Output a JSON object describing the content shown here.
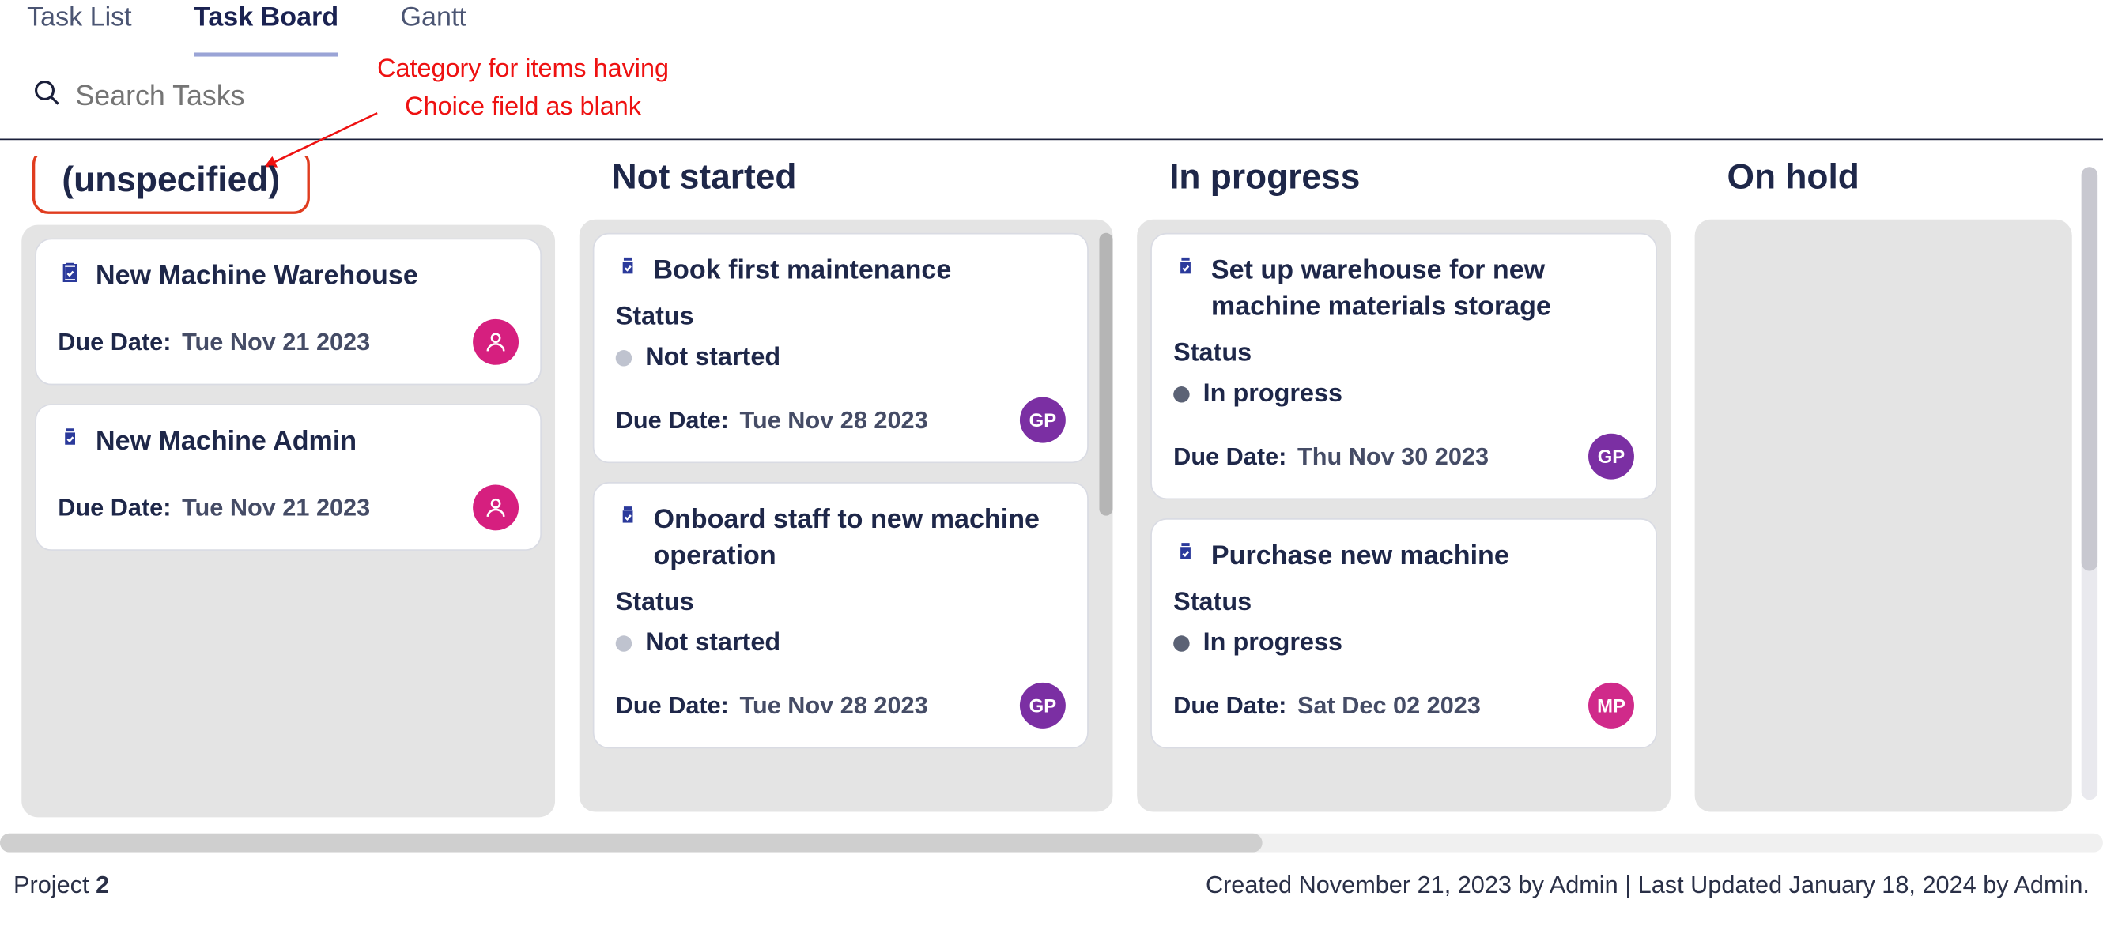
{
  "tabs": {
    "task_list": "Task List",
    "task_board": "Task Board",
    "gantt": "Gantt"
  },
  "search": {
    "placeholder": "Search Tasks"
  },
  "annotation": {
    "line1": "Category for items having",
    "line2": "Choice field as blank"
  },
  "labels": {
    "status": "Status",
    "due_date": "Due Date:"
  },
  "columns": {
    "unspecified": {
      "title": "(unspecified)",
      "cards": [
        {
          "title": "New Machine Warehouse",
          "due": "Tue Nov 21 2023",
          "avatar_type": "icon",
          "avatar_color": "pink"
        },
        {
          "title": "New Machine Admin",
          "due": "Tue Nov 21 2023",
          "avatar_type": "icon",
          "avatar_color": "pink"
        }
      ]
    },
    "not_started": {
      "title": "Not started",
      "cards": [
        {
          "title": "Book first maintenance",
          "status": "Not started",
          "status_dot": "grey",
          "due": "Tue Nov 28 2023",
          "avatar_type": "initials",
          "avatar_initials": "GP",
          "avatar_color": "purple"
        },
        {
          "title": "Onboard staff to new machine operation",
          "status": "Not started",
          "status_dot": "grey",
          "due": "Tue Nov 28 2023",
          "avatar_type": "initials",
          "avatar_initials": "GP",
          "avatar_color": "purple"
        }
      ]
    },
    "in_progress": {
      "title": "In progress",
      "cards": [
        {
          "title": "Set up warehouse for new machine materials storage",
          "status": "In progress",
          "status_dot": "dark",
          "due": "Thu Nov 30 2023",
          "avatar_type": "initials",
          "avatar_initials": "GP",
          "avatar_color": "purple"
        },
        {
          "title": "Purchase new machine",
          "status": "In progress",
          "status_dot": "dark",
          "due": "Sat Dec 02 2023",
          "avatar_type": "initials",
          "avatar_initials": "MP",
          "avatar_color": "magenta"
        }
      ]
    },
    "on_hold": {
      "title": "On hold",
      "cards": []
    }
  },
  "footer": {
    "project_label": "Project",
    "project_number": "2",
    "meta": "Created November 21, 2023 by Admin | Last Updated January 18, 2024 by Admin."
  }
}
